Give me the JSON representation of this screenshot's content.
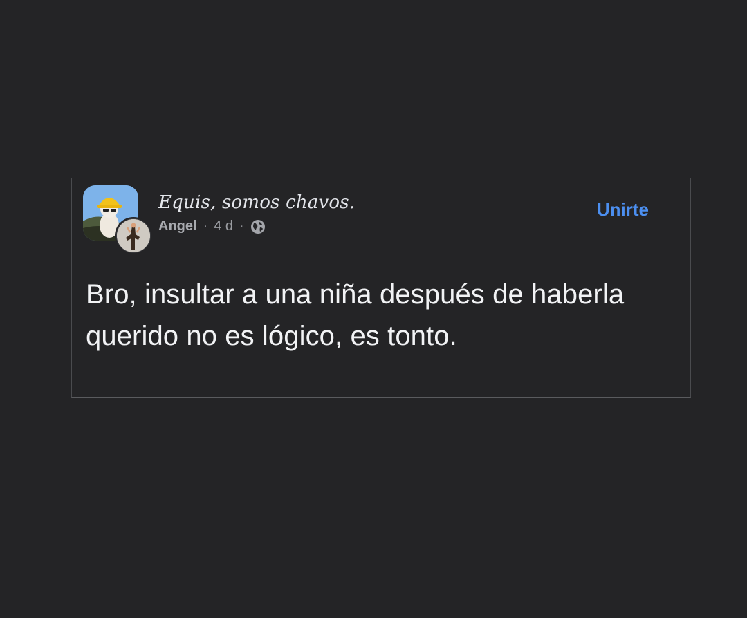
{
  "colors": {
    "background": "#242426",
    "border": "#4a4b4e",
    "primary_text": "#f2f3f5",
    "secondary_text": "#9a9ca1",
    "accent_link": "#4c8ff0"
  },
  "post": {
    "group_name": "Equis, somos chavos.",
    "author": "Angel",
    "separator": "·",
    "time_ago": "4 d",
    "privacy_icon": "globe-icon",
    "join_label": "Unirte",
    "body": "Bro, insultar a una niña después de haberla querido no es lógico, es tonto."
  }
}
